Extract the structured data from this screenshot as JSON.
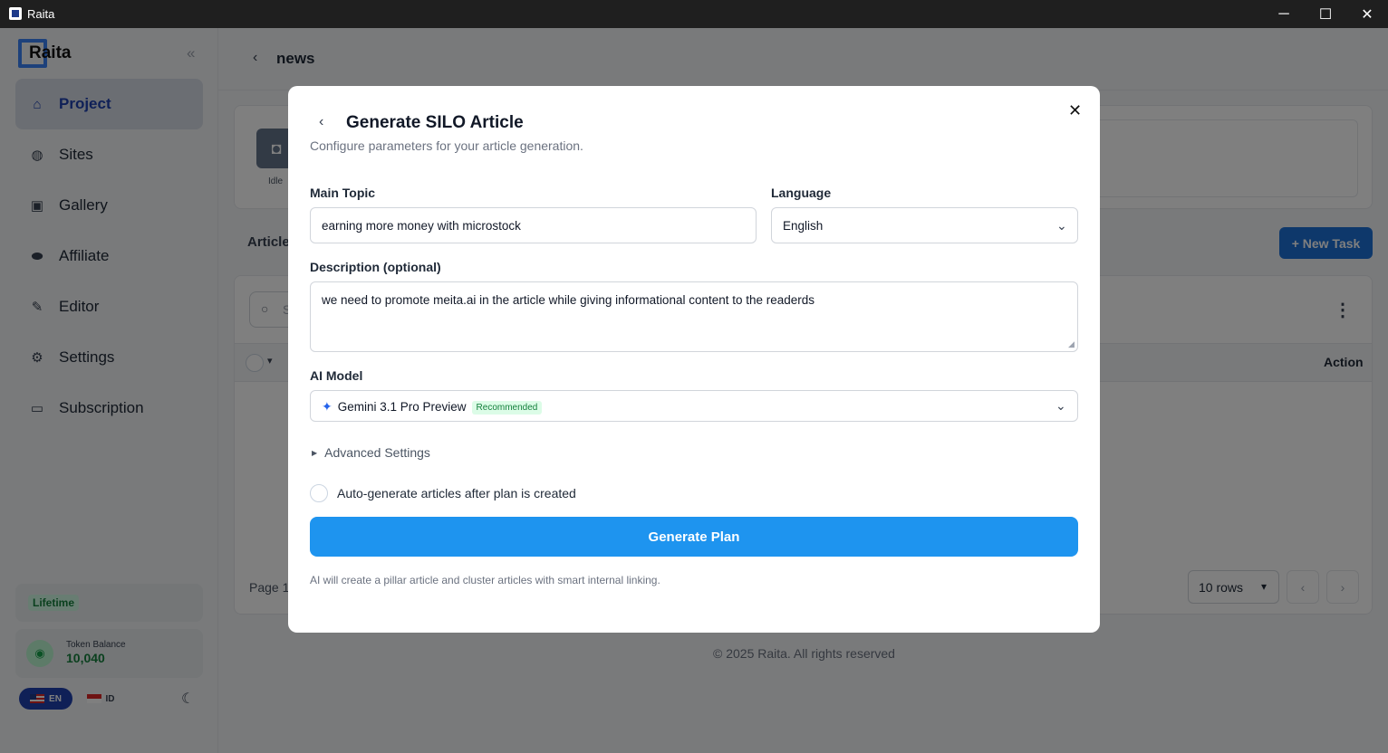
{
  "window": {
    "title": "Raita",
    "minimize": "─",
    "maximize": "☐",
    "close": "✕"
  },
  "sidebar": {
    "logo_text": "Raita",
    "items": [
      {
        "label": "Project",
        "icon": "home-icon",
        "active": true
      },
      {
        "label": "Sites",
        "icon": "globe-icon"
      },
      {
        "label": "Gallery",
        "icon": "image-icon"
      },
      {
        "label": "Affiliate",
        "icon": "handshake-icon"
      },
      {
        "label": "Editor",
        "icon": "pencil-icon"
      },
      {
        "label": "Settings",
        "icon": "gear-icon"
      },
      {
        "label": "Subscription",
        "icon": "card-icon"
      }
    ],
    "plan_badge": "Lifetime",
    "token_label": "Token Balance",
    "token_value": "10,040",
    "lang_en": "EN",
    "lang_id": "ID"
  },
  "header": {
    "title": "news"
  },
  "status": {
    "label": "Idle"
  },
  "tabs": {
    "article": "Article"
  },
  "buttons": {
    "new_task": "+ New Task"
  },
  "table": {
    "search_placeholder": "S",
    "action_header": "Action",
    "pager_text": "Page 1",
    "rows_per_page": "10 rows"
  },
  "footer": "© 2025 Raita. All rights reserved",
  "modal": {
    "title": "Generate SILO Article",
    "subtitle": "Configure parameters for your article generation.",
    "main_topic_label": "Main Topic",
    "main_topic_value": "earning more money with microstock",
    "language_label": "Language",
    "language_value": "English",
    "description_label": "Description (optional)",
    "description_value": "we need to promote meita.ai in the article while giving informational content to the readerds",
    "ai_model_label": "AI Model",
    "ai_model_value": "Gemini 3.1 Pro Preview",
    "ai_model_badge": "Recommended",
    "advanced_settings": "Advanced Settings",
    "auto_generate_label": "Auto-generate articles after plan is created",
    "generate_button": "Generate Plan",
    "footnote": "AI will create a pillar article and cluster articles with smart internal linking."
  }
}
